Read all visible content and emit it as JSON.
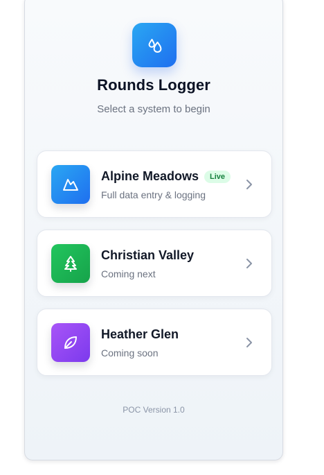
{
  "app": {
    "title": "Rounds Logger",
    "subtitle": "Select a system to begin",
    "logo_icon": "water-drops-icon",
    "version": "POC Version 1.0"
  },
  "systems": [
    {
      "name": "Alpine Meadows",
      "badge": "Live",
      "description": "Full data entry & logging",
      "icon": "mountain-icon",
      "icon_color": "#1f6ff0"
    },
    {
      "name": "Christian Valley",
      "badge": "",
      "description": "Coming next",
      "icon": "pine-tree-icon",
      "icon_color": "#16a34a"
    },
    {
      "name": "Heather Glen",
      "badge": "",
      "description": "Coming soon",
      "icon": "leaf-icon",
      "icon_color": "#7c3aed"
    }
  ],
  "colors": {
    "brand": "#1f6ff0",
    "badge_bg": "#dcfce7",
    "badge_text": "#15803d",
    "text_primary": "#111827",
    "text_secondary": "#6b7280"
  }
}
